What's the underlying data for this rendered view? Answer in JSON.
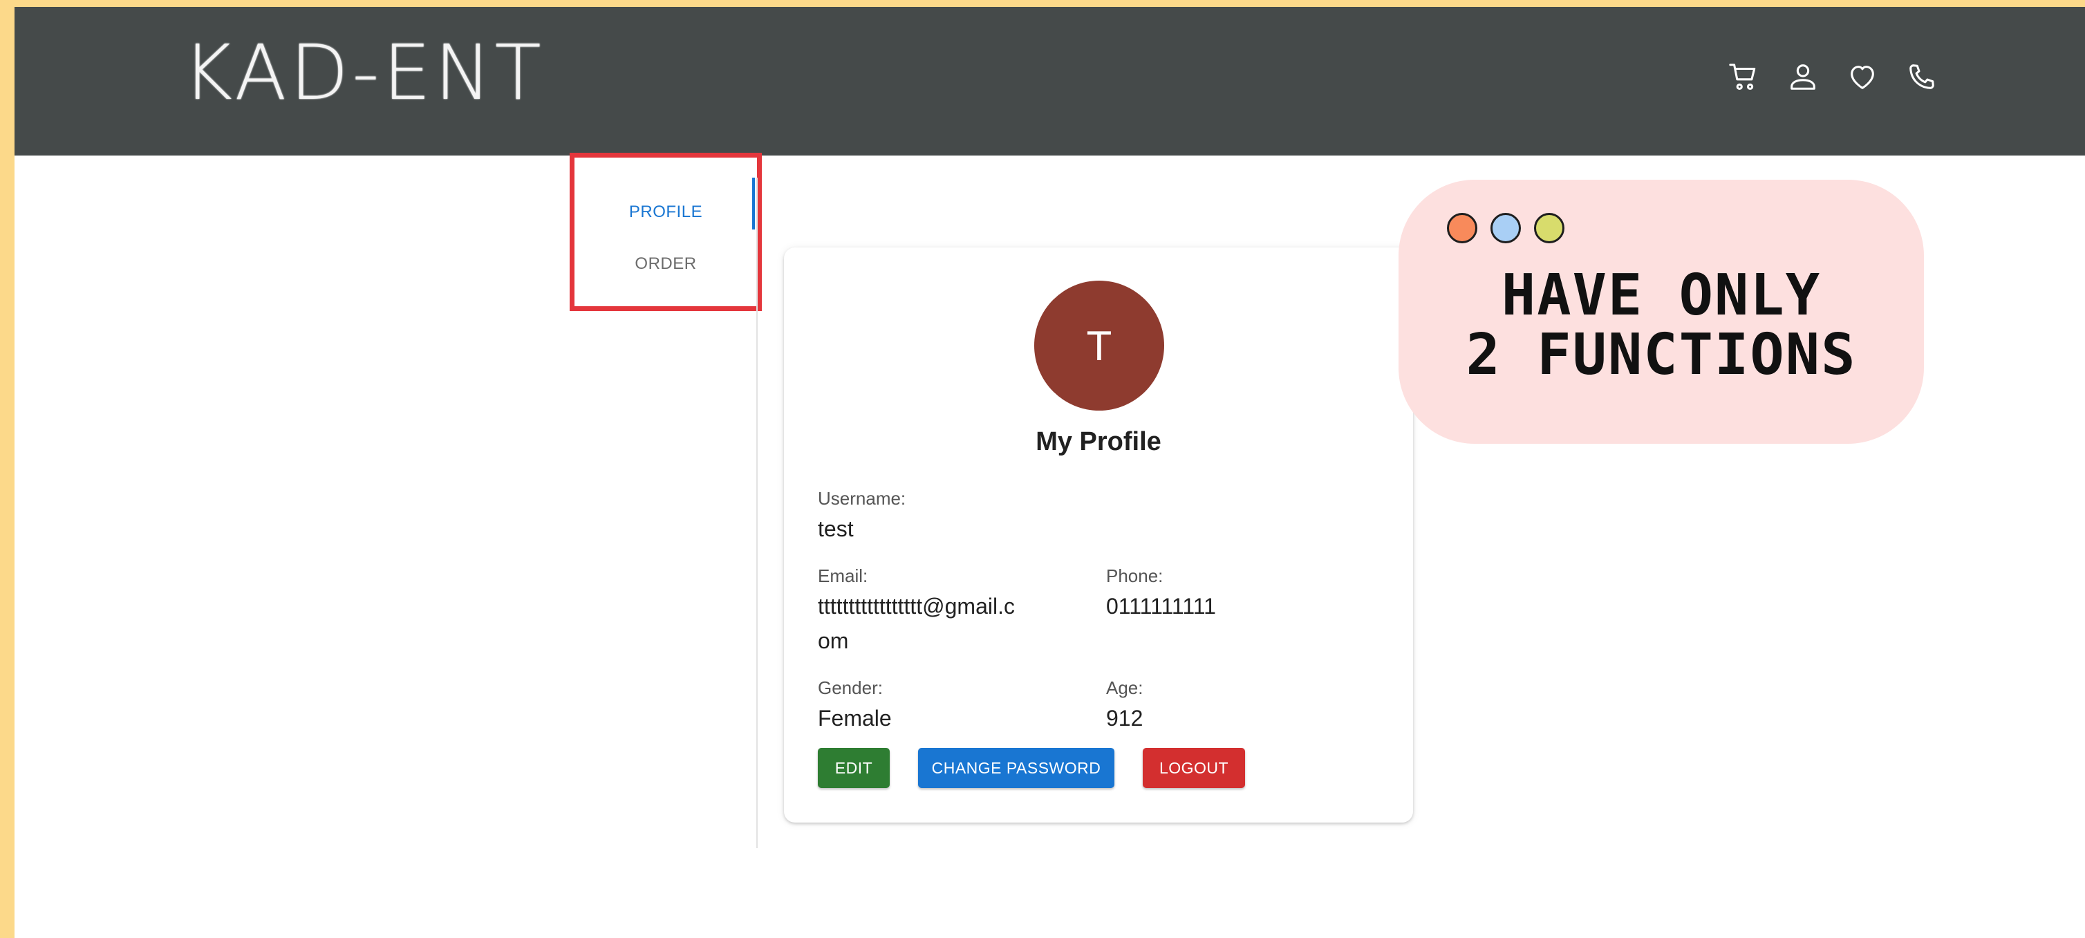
{
  "header": {
    "logo": "KAD-ENT",
    "icons": [
      "cart-icon",
      "user-icon",
      "heart-icon",
      "phone-icon"
    ]
  },
  "tabs": [
    {
      "label": "PROFILE",
      "active": true
    },
    {
      "label": "ORDER",
      "active": false
    }
  ],
  "profile": {
    "avatar_letter": "T",
    "title": "My Profile",
    "username_label": "Username:",
    "username": "test",
    "email_label": "Email:",
    "email_line1": "ttttttttttttttttt@gmail.c",
    "email_line2": "om",
    "phone_label": "Phone:",
    "phone": "0111111111",
    "gender_label": "Gender:",
    "gender": "Female",
    "age_label": "Age:",
    "age": "912"
  },
  "actions": {
    "edit": "EDIT",
    "change_password": "CHANGE PASSWORD",
    "logout": "LOGOUT"
  },
  "callout": {
    "text": "HAVE ONLY\n2 FUNCTIONS",
    "dot_colors": [
      "#f88a5b",
      "#a9cff5",
      "#d8dc6c"
    ]
  },
  "colors": {
    "header_bg": "#454a4a",
    "accent": "#1976d2",
    "edit": "#2e7d32",
    "logout": "#d32f2f",
    "avatar": "#8e3b2f",
    "highlight_box": "#e4363c",
    "page_border": "#fcd98a"
  }
}
